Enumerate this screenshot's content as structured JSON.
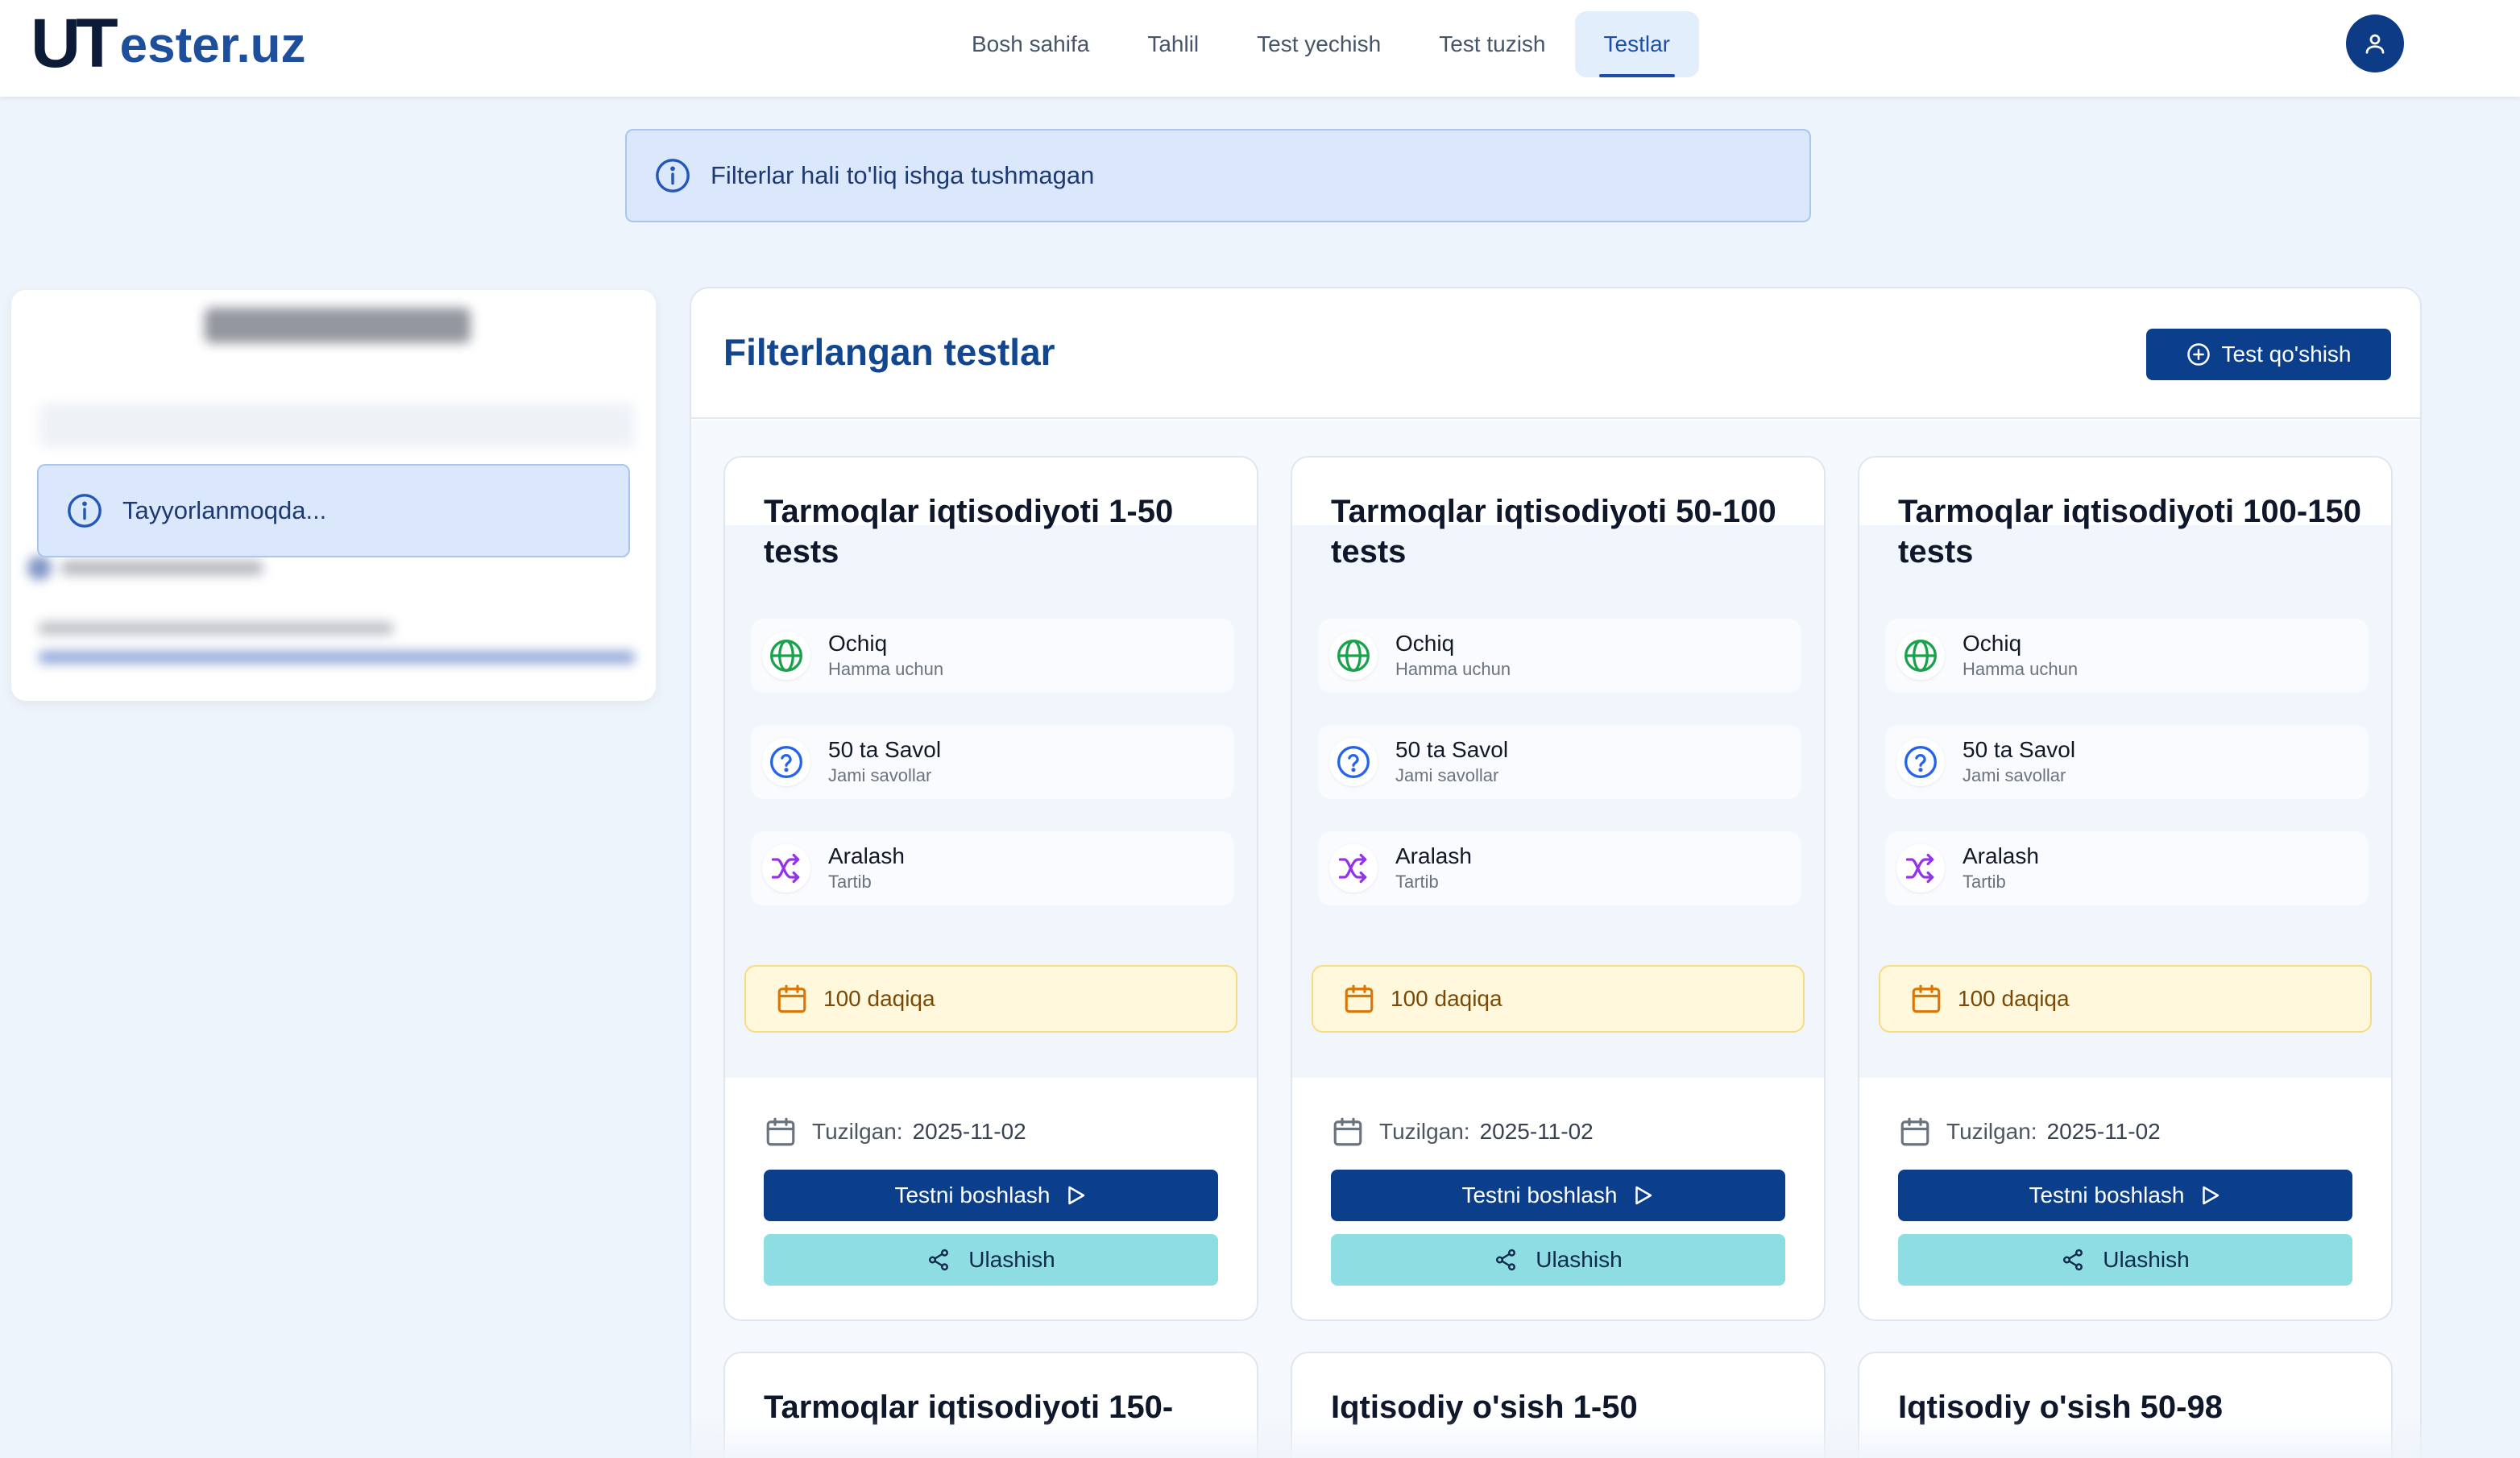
{
  "header": {
    "logo_u": "U",
    "logo_t": "T",
    "logo_rest": "ester.uz",
    "nav": [
      "Bosh sahifa",
      "Tahlil",
      "Test yechish",
      "Test tuzish",
      "Testlar"
    ],
    "active_nav": "Testlar",
    "avatar_icon": "user-icon"
  },
  "banner": {
    "text": "Filterlar hali to'liq ishga tushmagan",
    "icon": "info-icon"
  },
  "sidebar": {
    "alert_text": "Tayyorlanmoqda...",
    "alert_icon": "info-icon"
  },
  "main": {
    "title": "Filterlangan testlar",
    "add_button": "Test qo'shish",
    "cards": [
      {
        "title": "Tarmoqlar iqtisodiyoti 1-50 tests",
        "access": "Ochiq",
        "access_sub": "Hamma uchun",
        "questions": "50 ta Savol",
        "questions_sub": "Jami savollar",
        "order": "Aralash",
        "order_sub": "Tartib",
        "duration": "100 daqiqa",
        "created_label": "Tuzilgan:",
        "created_date": "2025-11-02",
        "start": "Testni boshlash",
        "share": "Ulashish"
      },
      {
        "title": "Tarmoqlar iqtisodiyoti 50-100 tests",
        "access": "Ochiq",
        "access_sub": "Hamma uchun",
        "questions": "50 ta Savol",
        "questions_sub": "Jami savollar",
        "order": "Aralash",
        "order_sub": "Tartib",
        "duration": "100 daqiqa",
        "created_label": "Tuzilgan:",
        "created_date": "2025-11-02",
        "start": "Testni boshlash",
        "share": "Ulashish"
      },
      {
        "title": "Tarmoqlar iqtisodiyoti 100-150 tests",
        "access": "Ochiq",
        "access_sub": "Hamma uchun",
        "questions": "50 ta Savol",
        "questions_sub": "Jami savollar",
        "order": "Aralash",
        "order_sub": "Tartib",
        "duration": "100 daqiqa",
        "created_label": "Tuzilgan:",
        "created_date": "2025-11-02",
        "start": "Testni boshlash",
        "share": "Ulashish"
      }
    ],
    "next_cards": [
      {
        "title": "Tarmoqlar iqtisodiyoti 150-"
      },
      {
        "title": "Iqtisodiy o'sish 1-50"
      },
      {
        "title": "Iqtisodiy o'sish 50-98"
      }
    ]
  },
  "colors": {
    "primary": "#0b3f8c",
    "accent_light": "#dbe8fb",
    "share": "#8ddde3",
    "duration_bg": "#fff8dc",
    "globe": "#16a34a",
    "question": "#2563eb",
    "shuffle": "#9333ea",
    "calendar": "#d97706"
  }
}
